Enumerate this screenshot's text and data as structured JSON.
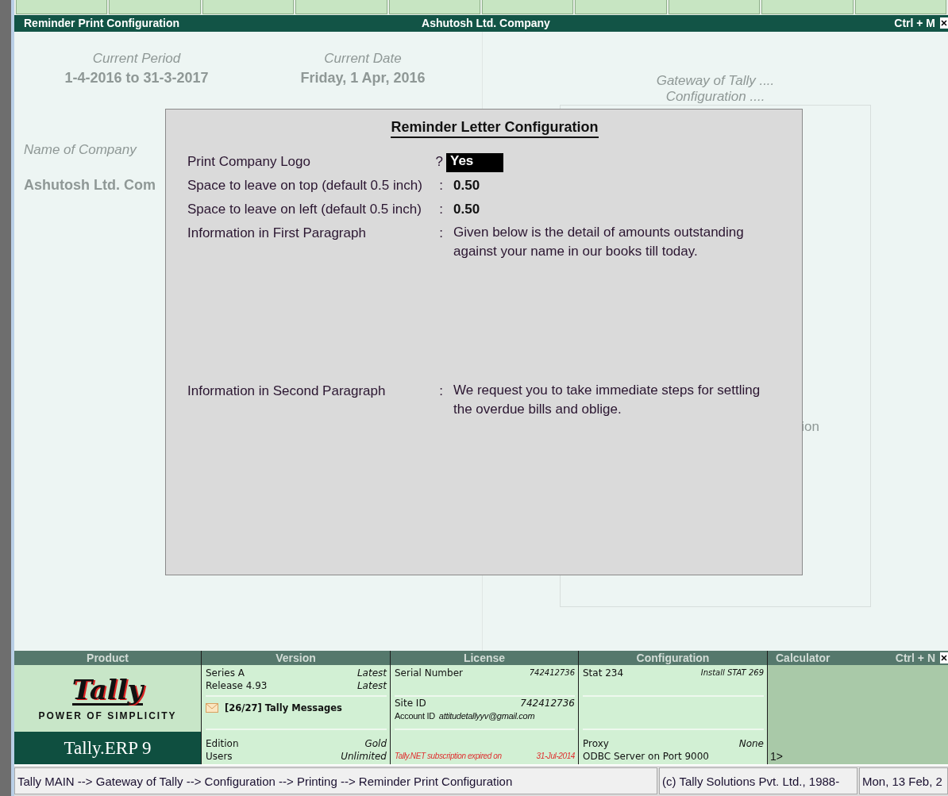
{
  "title_bar": {
    "left": "Reminder Print Configuration",
    "center": "Ashutosh  Ltd. Company",
    "shortcut": "Ctrl + M"
  },
  "background": {
    "period_label": "Current Period",
    "period_value": "1-4-2016 to 31-3-2017",
    "date_label": "Current Date",
    "date_value": "Friday, 1 Apr, 2016",
    "company_label": "Name of Company",
    "company_value": "Ashutosh  Ltd. Com",
    "gateway_line1": "Gateway of Tally ....",
    "gateway_line2": "Configuration ....",
    "fragment": "ion"
  },
  "dialog": {
    "title": "Reminder Letter Configuration",
    "fields": [
      {
        "kind": "choice",
        "label": "Print Company Logo",
        "separator": "?",
        "value": "Yes"
      },
      {
        "kind": "number",
        "label": "Space to leave on top (default 0.5 inch)",
        "separator": ":",
        "value": "0.50"
      },
      {
        "kind": "number",
        "label": "Space to leave on left (default 0.5 inch)",
        "separator": ":",
        "value": "0.50"
      },
      {
        "kind": "paragraph",
        "label": "Information in First Paragraph",
        "separator": ":",
        "value": "Given below is the detail of amounts outstanding against your name in our books till today."
      },
      {
        "kind": "paragraph",
        "label": "Information in Second Paragraph",
        "separator": ":",
        "value": "We request you to take immediate steps for settling the overdue bills and oblige."
      }
    ]
  },
  "info_panel": {
    "product": {
      "heading": "Product",
      "logo": "Tally",
      "tagline": "POWER OF SIMPLICITY",
      "name": "Tally.ERP 9"
    },
    "columns": [
      {
        "heading": "Version",
        "top": [
          {
            "kind": "pair",
            "label": "Series A",
            "value": "Latest"
          },
          {
            "kind": "pair",
            "label": "Release 4.93",
            "value": "Latest"
          }
        ],
        "middle": [
          {
            "kind": "message",
            "label": "[26/27] Tally Messages"
          }
        ],
        "bottom": [
          {
            "kind": "pair",
            "label": "Edition",
            "value": "Gold"
          },
          {
            "kind": "pair",
            "label": "Users",
            "value": "Unlimited"
          }
        ]
      },
      {
        "heading": "License",
        "top": [
          {
            "kind": "pair",
            "label": "Serial Number",
            "value": "742412736",
            "small_value": true
          }
        ],
        "middle": [
          {
            "kind": "pair",
            "label": "Site ID",
            "value": "742412736"
          },
          {
            "kind": "account",
            "label": "Account ID",
            "value": "attitudetallyyv@gmail.com"
          }
        ],
        "bottom": [
          {
            "kind": "notice",
            "label": "Tally.NET subscription expired on",
            "value": "31-Jul-2014"
          }
        ]
      },
      {
        "heading": "Configuration",
        "top": [
          {
            "kind": "pair",
            "label": "Stat  234",
            "value": "Install STAT  269",
            "small_value": true
          }
        ],
        "bottom": [
          {
            "kind": "pair",
            "label": "Proxy",
            "value": "None"
          },
          {
            "kind": "plain",
            "label": "ODBC Server on Port 9000"
          }
        ]
      }
    ],
    "calculator": {
      "heading": "Calculator",
      "shortcut": "Ctrl + N",
      "prompt": "1>"
    }
  },
  "status_bar": {
    "path": "Tally MAIN --> Gateway of Tally --> Configuration --> Printing --> Reminder Print Configuration",
    "copyright": "(c) Tally Solutions Pvt. Ltd., 1988-",
    "date": "Mon, 13 Feb, 2"
  }
}
